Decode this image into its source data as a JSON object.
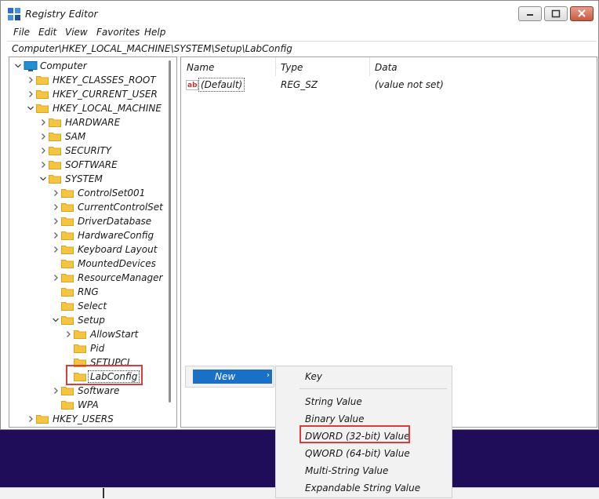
{
  "window": {
    "title": "Registry Editor"
  },
  "menu": [
    "File",
    "Edit",
    "View",
    "Favorites",
    "Help"
  ],
  "address": "Computer\\HKEY_LOCAL_MACHINE\\SYSTEM\\Setup\\LabConfig",
  "tree": [
    {
      "label": "Computer",
      "chev": "v",
      "icon": "computer-icon",
      "level": 0
    },
    {
      "label": "HKEY_CLASSES_ROOT",
      "chev": ">",
      "level": 1
    },
    {
      "label": "HKEY_CURRENT_USER",
      "chev": ">",
      "level": 1
    },
    {
      "label": "HKEY_LOCAL_MACHINE",
      "chev": "v",
      "level": 1
    },
    {
      "label": "HARDWARE",
      "chev": ">",
      "level": 2
    },
    {
      "label": "SAM",
      "chev": ">",
      "level": 2
    },
    {
      "label": "SECURITY",
      "chev": ">",
      "level": 2
    },
    {
      "label": "SOFTWARE",
      "chev": ">",
      "level": 2
    },
    {
      "label": "SYSTEM",
      "chev": "v",
      "level": 2
    },
    {
      "label": "ControlSet001",
      "chev": ">",
      "level": 3
    },
    {
      "label": "CurrentControlSet",
      "chev": ">",
      "level": 3
    },
    {
      "label": "DriverDatabase",
      "chev": ">",
      "level": 3
    },
    {
      "label": "HardwareConfig",
      "chev": ">",
      "level": 3
    },
    {
      "label": "Keyboard Layout",
      "chev": ">",
      "level": 3
    },
    {
      "label": "MountedDevices",
      "chev": "",
      "level": 3
    },
    {
      "label": "ResourceManager",
      "chev": ">",
      "level": 3
    },
    {
      "label": "RNG",
      "chev": "",
      "level": 3
    },
    {
      "label": "Select",
      "chev": "",
      "level": 3
    },
    {
      "label": "Setup",
      "chev": "v",
      "level": 3
    },
    {
      "label": "AllowStart",
      "chev": ">",
      "level": 4
    },
    {
      "label": "Pid",
      "chev": "",
      "level": 4
    },
    {
      "label": "SETUPCL",
      "chev": "",
      "level": 4
    },
    {
      "label": "LabConfig",
      "chev": "",
      "level": 4,
      "selected": true
    },
    {
      "label": "Software",
      "chev": ">",
      "level": 3
    },
    {
      "label": "WPA",
      "chev": "",
      "level": 3
    },
    {
      "label": "HKEY_USERS",
      "chev": ">",
      "level": 1
    }
  ],
  "list": {
    "columns": [
      "Name",
      "Type",
      "Data"
    ],
    "rows": [
      {
        "name": "(Default)",
        "type": "REG_SZ",
        "data": "(value not set)"
      }
    ]
  },
  "context_menu": {
    "new_label": "New",
    "arrow": "›"
  },
  "submenu": {
    "items": [
      "Key",
      "String Value",
      "Binary Value",
      "DWORD (32-bit) Value",
      "QWORD (64-bit) Value",
      "Multi-String Value",
      "Expandable String Value"
    ]
  },
  "colors": {
    "accent": "#1a70c6",
    "highlight_border": "#d93c3c",
    "folder": "#f4c542",
    "desktop": "#1f0d5a"
  }
}
